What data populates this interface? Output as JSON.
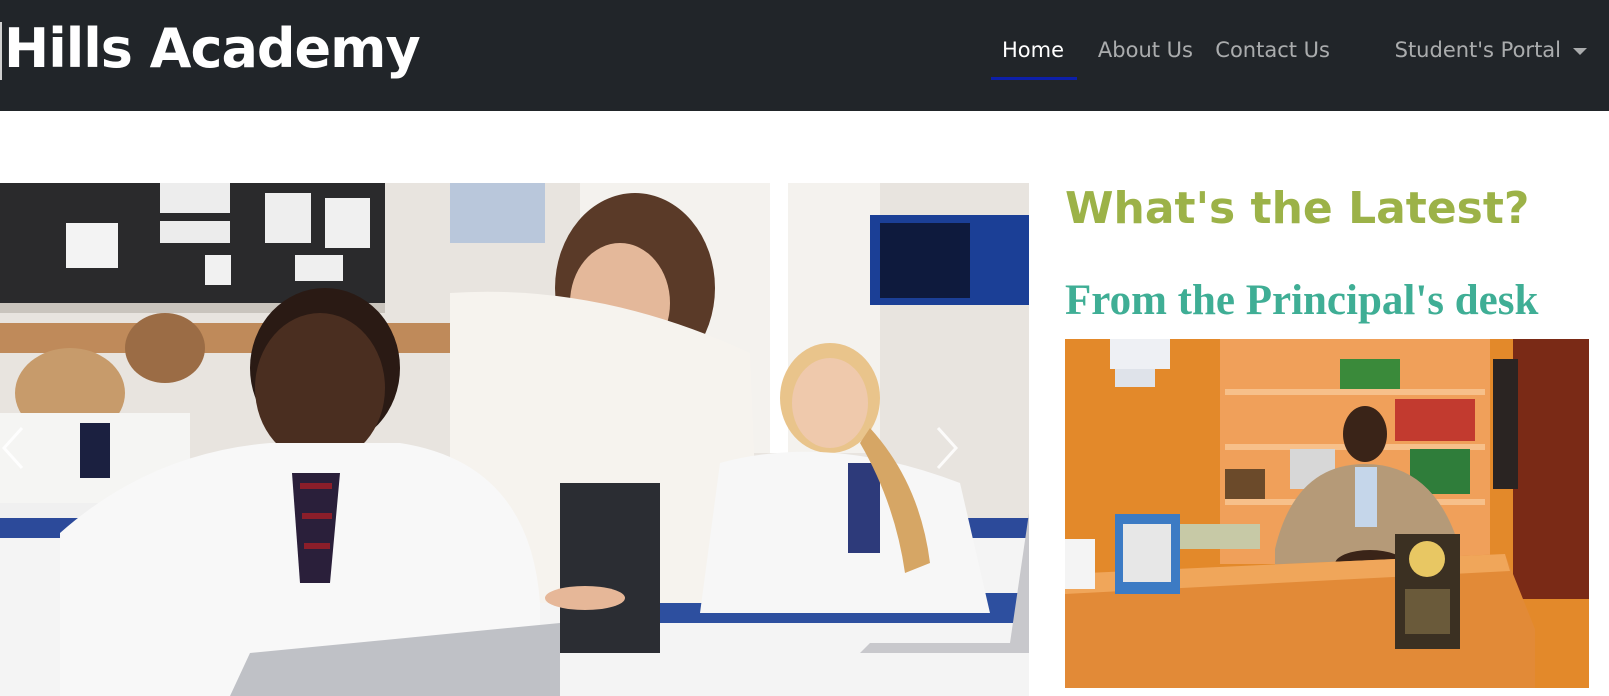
{
  "header": {
    "brand": "Hills Academy",
    "nav": [
      {
        "label": "Home",
        "active": true
      },
      {
        "label": "About Us",
        "active": false
      },
      {
        "label": "Contact Us",
        "active": false
      },
      {
        "label": "Student's Portal",
        "active": false,
        "dropdown": true
      }
    ]
  },
  "carousel": {
    "image": "classroom-photo",
    "prev_icon": "chevron-left-icon",
    "next_icon": "chevron-right-icon"
  },
  "sidebar": {
    "heading": "What's the Latest?",
    "subheading": "From the Principal's desk",
    "photo": "principal-photo"
  },
  "colors": {
    "navbar_bg": "#212529",
    "active_underline": "#0d1fa8",
    "heading": "#9cb248",
    "subheading": "#3fae95"
  }
}
